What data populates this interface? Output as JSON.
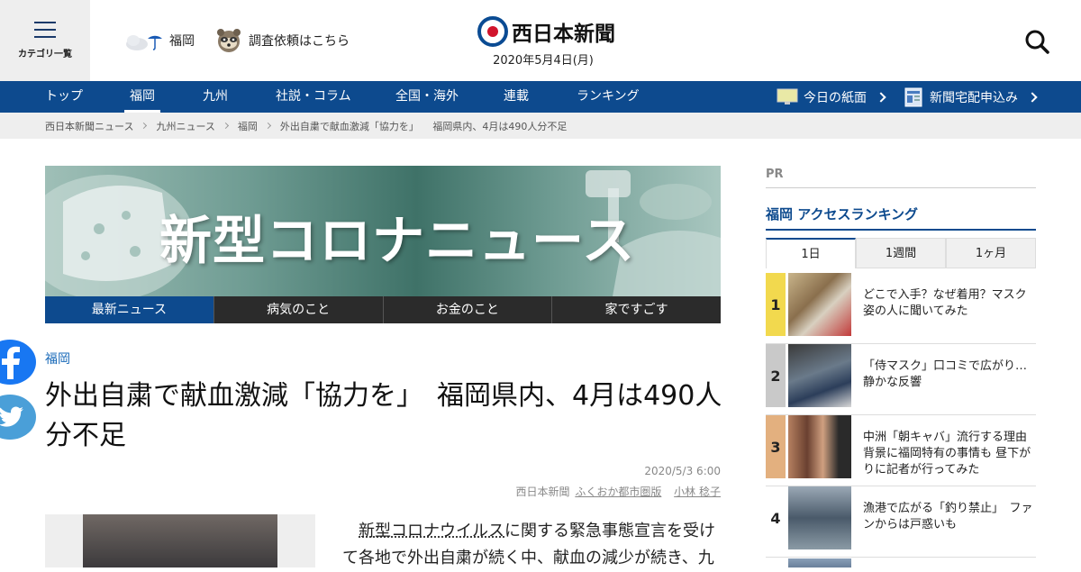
{
  "header": {
    "menu_label": "カテゴリ一覧",
    "weather_city": "福岡",
    "request_label": "調査依頼はこちら",
    "logo_text": "西日本新聞",
    "date": "2020年5月4日(月)"
  },
  "nav": {
    "items": [
      {
        "label": "トップ"
      },
      {
        "label": "福岡"
      },
      {
        "label": "九州"
      },
      {
        "label": "社説・コラム"
      },
      {
        "label": "全国・海外"
      },
      {
        "label": "連載"
      },
      {
        "label": "ランキング"
      }
    ],
    "active": "福岡",
    "paper_today": "今日の紙面",
    "subscribe": "新聞宅配申込み"
  },
  "breadcrumb": {
    "items": [
      "西日本新聞ニュース",
      "九州ニュース",
      "福岡",
      "外出自粛で献血激減「協力を」"
    ],
    "current": "福岡県内、4月は490人分不足"
  },
  "banner": {
    "title": "新型コロナニュース",
    "tabs": [
      "最新ニュース",
      "病気のこと",
      "お金のこと",
      "家ですごす"
    ]
  },
  "article": {
    "category": "福岡",
    "headline": "外出自粛で献血激減「協力を」　福岡県内、4月は490人分不足",
    "date": "2020/5/3 6:00",
    "source": "西日本新聞",
    "department": "ふくおか都市圏版",
    "author": "小林 稔子",
    "body_link": "新型コロナウイルス",
    "body_rest": "に関する緊急事態宣言を受けて各地で外出自粛が続く中、献血の減少が続き、九"
  },
  "sidebar": {
    "pr_label": "PR",
    "ranking_title": "福岡 アクセスランキング",
    "tabs": [
      "1日",
      "1週間",
      "1ヶ月"
    ],
    "items": [
      {
        "rank": "1",
        "text": "どこで入手？なぜ着用？マスク姿の人に聞いてみた",
        "color": "#f2d94e"
      },
      {
        "rank": "2",
        "text": "「侍マスク」口コミで広がり…静かな反響",
        "color": "#c9c9c9"
      },
      {
        "rank": "3",
        "text": "中洲「朝キャバ」流行する理由　背景に福岡特有の事情も 昼下がりに記者が行ってみた",
        "color": "#e3b07f"
      },
      {
        "rank": "4",
        "text": "漁港で広がる「釣り禁止」　ファンからは戸惑いも",
        "color": "#ffffff"
      }
    ]
  },
  "colors": {
    "brand_blue": "#0d4a8e",
    "logo_red": "#d1142c",
    "facebook": "#1877f2",
    "twitter": "#4a9fd8"
  }
}
